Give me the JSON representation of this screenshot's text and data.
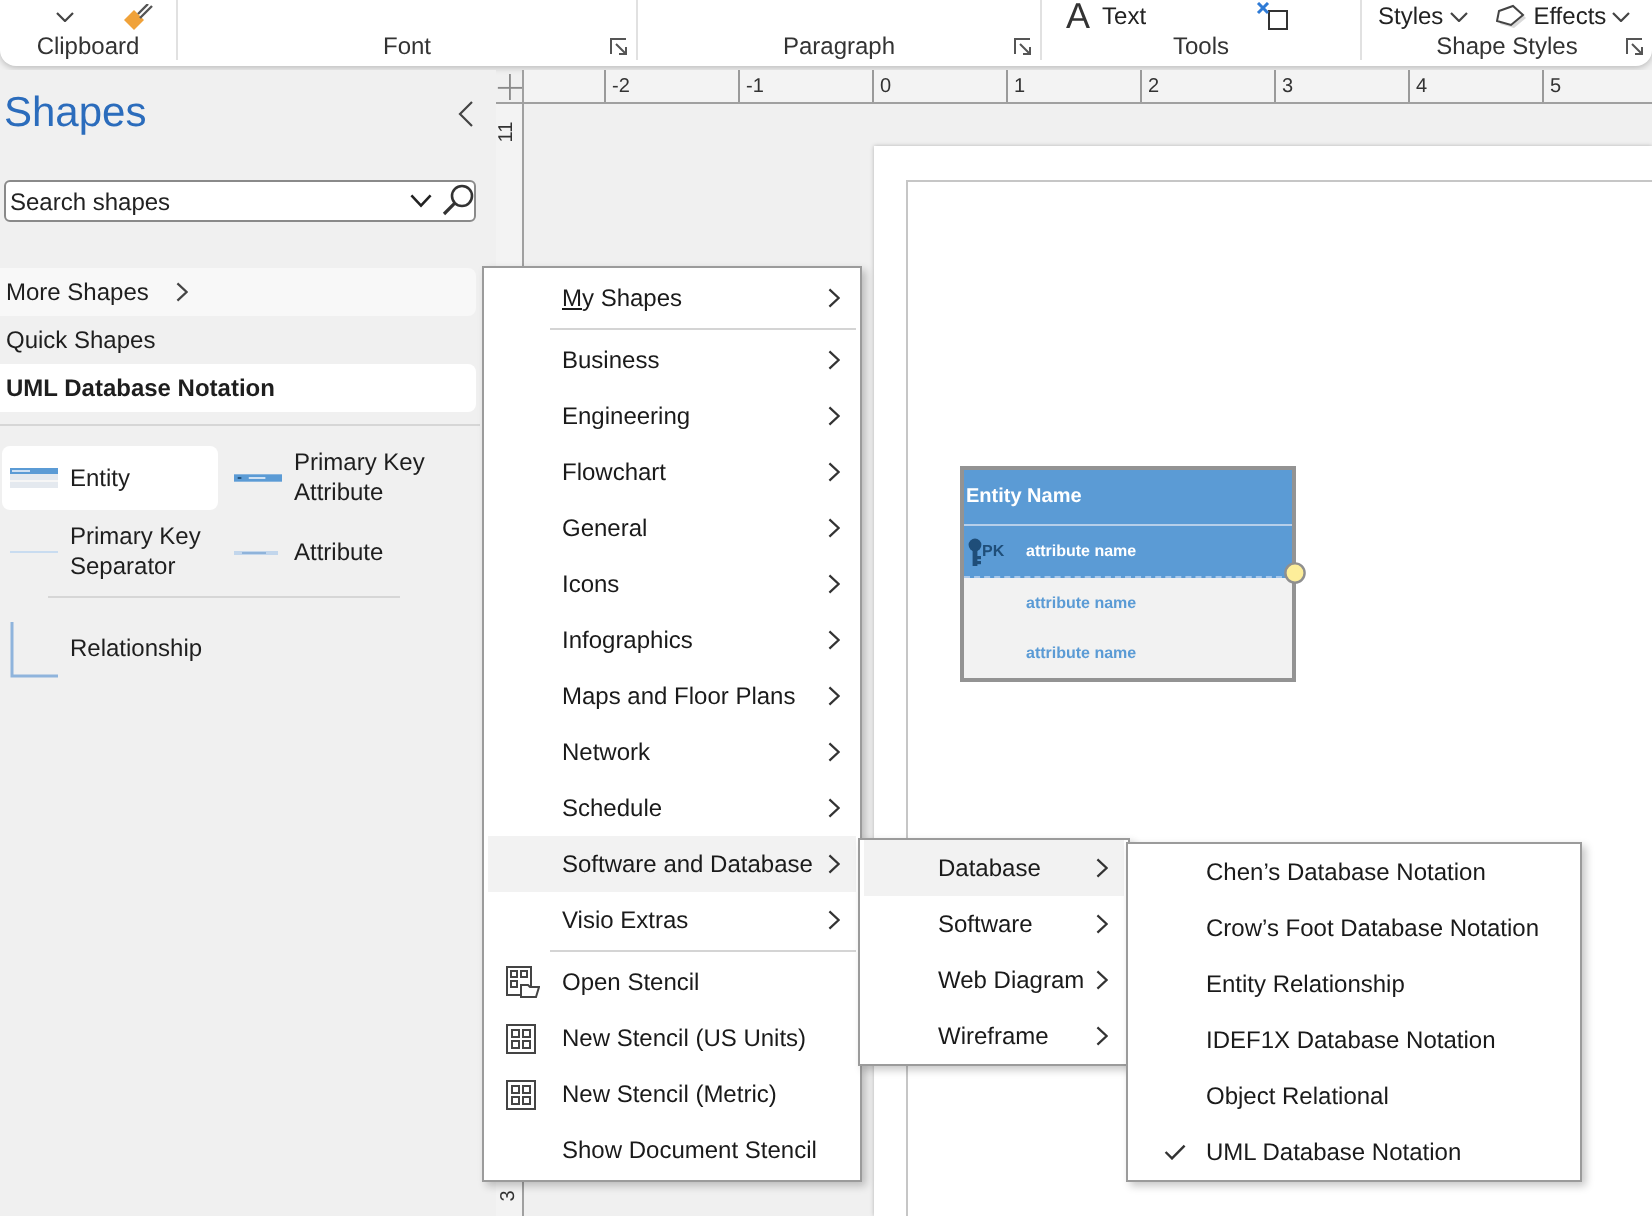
{
  "ribbon": {
    "groups": [
      {
        "label": "Clipboard",
        "launcher": false,
        "items": [
          {
            "kind": "caret"
          },
          {
            "kind": "painter"
          }
        ]
      },
      {
        "label": "Font",
        "launcher": true
      },
      {
        "label": "Paragraph",
        "launcher": true
      },
      {
        "label": "Tools",
        "launcher": false,
        "items": [
          {
            "kind": "text",
            "glyph": "A",
            "label": "Text"
          },
          {
            "kind": "connector"
          }
        ]
      },
      {
        "label": "Shape Styles",
        "launcher": true,
        "items": [
          {
            "kind": "dropdown",
            "label": "Styles"
          },
          {
            "kind": "effects",
            "label": "Effects"
          }
        ]
      }
    ]
  },
  "shapes_panel": {
    "title": "Shapes",
    "search": {
      "placeholder": "Search shapes"
    },
    "nav": [
      {
        "label": "More Shapes",
        "kind": "submenu",
        "selected": false
      },
      {
        "label": "Quick Shapes",
        "kind": "plain",
        "selected": false
      },
      {
        "label": "UML Database Notation",
        "kind": "plain",
        "selected": true
      }
    ],
    "stencil": [
      [
        {
          "label": "Entity",
          "kind": "entity",
          "selected": true
        },
        {
          "label": "Primary Key Attribute",
          "kind": "pkattribute",
          "selected": false
        },
        {
          "label": "Primary Key Separator",
          "kind": "separator",
          "selected": false
        },
        {
          "label": "Attribute",
          "kind": "attribute",
          "selected": false
        }
      ],
      [
        {
          "label": "Relationship",
          "kind": "relationship",
          "selected": false
        }
      ]
    ]
  },
  "rulers": {
    "horizontal": [
      "-2",
      "-1",
      "0",
      "1",
      "2",
      "3",
      "4",
      "5"
    ],
    "vertical": [
      "11",
      "3"
    ]
  },
  "canvas": {
    "entity": {
      "title": "Entity Name",
      "rows": [
        {
          "key": "PK",
          "name": "attribute name",
          "primary": true
        },
        {
          "name": "attribute name",
          "primary": false
        },
        {
          "name": "attribute name",
          "primary": false
        }
      ]
    }
  },
  "more_shapes_menu": {
    "sections": [
      [
        {
          "label": "My Shapes",
          "kind": "submenu",
          "access_key_shown": true,
          "selected": false
        }
      ],
      [
        {
          "label": "Business",
          "kind": "submenu",
          "access_key_shown": false,
          "selected": false
        },
        {
          "label": "Engineering",
          "kind": "submenu",
          "access_key_shown": false,
          "selected": false
        },
        {
          "label": "Flowchart",
          "kind": "submenu",
          "access_key_shown": false,
          "selected": false
        },
        {
          "label": "General",
          "kind": "submenu",
          "access_key_shown": false,
          "selected": false
        },
        {
          "label": "Icons",
          "kind": "submenu",
          "access_key_shown": false,
          "selected": false
        },
        {
          "label": "Infographics",
          "kind": "submenu",
          "access_key_shown": false,
          "selected": false
        },
        {
          "label": "Maps and Floor Plans",
          "kind": "submenu",
          "access_key_shown": false,
          "selected": false
        },
        {
          "label": "Network",
          "kind": "submenu",
          "access_key_shown": false,
          "selected": false
        },
        {
          "label": "Schedule",
          "kind": "submenu",
          "access_key_shown": false,
          "selected": false
        },
        {
          "label": "Software and Database",
          "kind": "submenu",
          "access_key_shown": false,
          "selected": true
        },
        {
          "label": "Visio Extras",
          "kind": "submenu",
          "access_key_shown": false,
          "selected": false
        }
      ],
      [
        {
          "label": "Open Stencil",
          "kind": "open",
          "access_key_shown": false,
          "selected": false
        },
        {
          "label": "New Stencil (US Units)",
          "kind": "new",
          "access_key_shown": false,
          "selected": false
        },
        {
          "label": "New Stencil (Metric)",
          "kind": "new",
          "access_key_shown": false,
          "selected": false
        },
        {
          "label": "Show Document Stencil",
          "kind": "command",
          "access_key_shown": false,
          "selected": false
        }
      ]
    ]
  },
  "software_submenu": {
    "items": [
      {
        "label": "Database",
        "selected": true
      },
      {
        "label": "Software",
        "selected": false
      },
      {
        "label": "Web Diagram",
        "selected": false
      },
      {
        "label": "Wireframe",
        "selected": false
      }
    ]
  },
  "database_submenu": {
    "items": [
      {
        "label": "Chen’s Database Notation",
        "checked": false
      },
      {
        "label": "Crow’s Foot Database Notation",
        "checked": false
      },
      {
        "label": "Entity Relationship",
        "checked": false
      },
      {
        "label": "IDEF1X Database Notation",
        "checked": false
      },
      {
        "label": "Object Relational",
        "checked": false
      },
      {
        "label": "UML Database Notation",
        "checked": true
      }
    ]
  }
}
